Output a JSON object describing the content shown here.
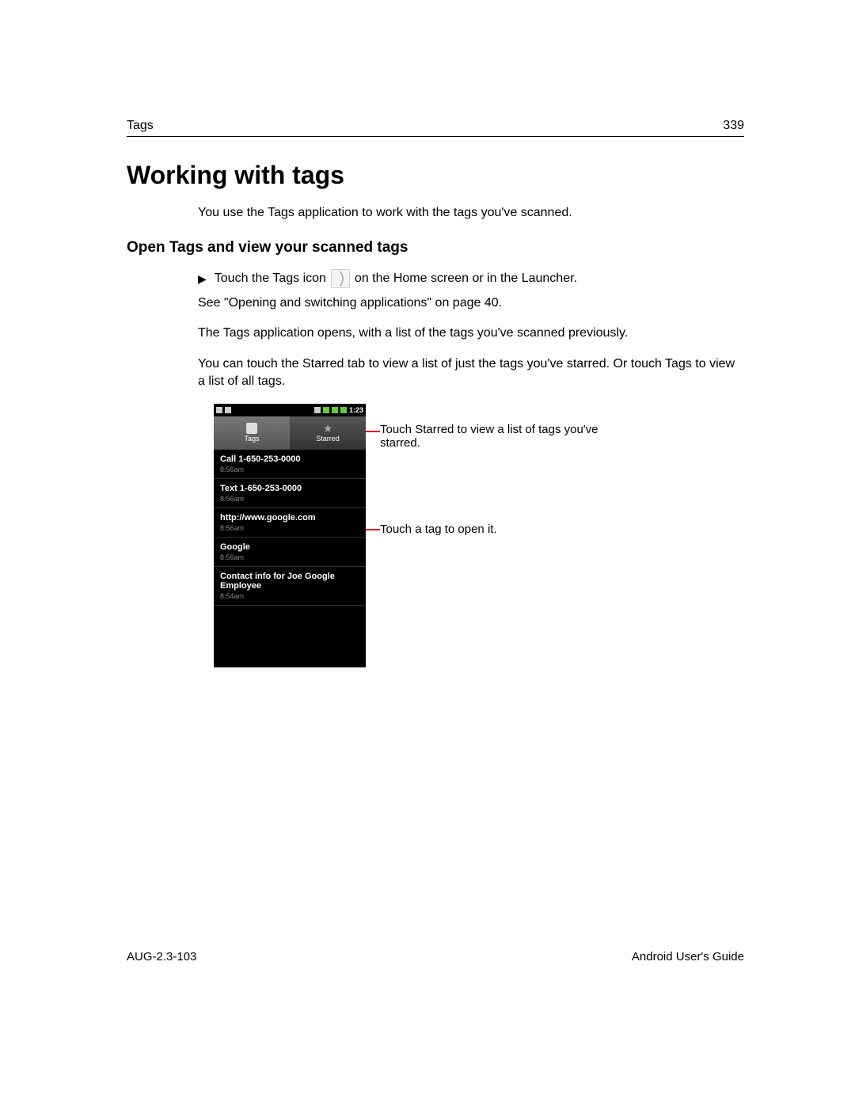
{
  "header": {
    "section": "Tags",
    "page_number": "339"
  },
  "title": "Working with tags",
  "intro": "You use the Tags application to work with the tags you've scanned.",
  "subheading": "Open Tags and view your scanned tags",
  "step": {
    "pre": "Touch the Tags icon",
    "post": "on the Home screen or in the Launcher."
  },
  "para1": "See \"Opening and switching applications\" on page 40.",
  "para2": "The Tags application opens, with a list of the tags you've scanned previously.",
  "para3": "You can touch the Starred tab to view a list of just the tags you've starred. Or touch Tags to view a list of all tags.",
  "phone": {
    "time": "1:23",
    "tabs": {
      "tags": "Tags",
      "starred": "Starred"
    },
    "items": [
      {
        "title": "Call 1-650-253-0000",
        "time": "8:56am"
      },
      {
        "title": "Text 1-650-253-0000",
        "time": "8:56am"
      },
      {
        "title": "http://www.google.com",
        "time": "8:56am"
      },
      {
        "title": "Google",
        "time": "8:56am"
      },
      {
        "title": "Contact info for Joe Google Employee",
        "time": "8:54am"
      }
    ]
  },
  "callouts": {
    "starred": "Touch Starred to view a list of tags you've starred.",
    "open": "Touch a tag to open it."
  },
  "footer": {
    "left": "AUG-2.3-103",
    "right": "Android User's Guide"
  }
}
